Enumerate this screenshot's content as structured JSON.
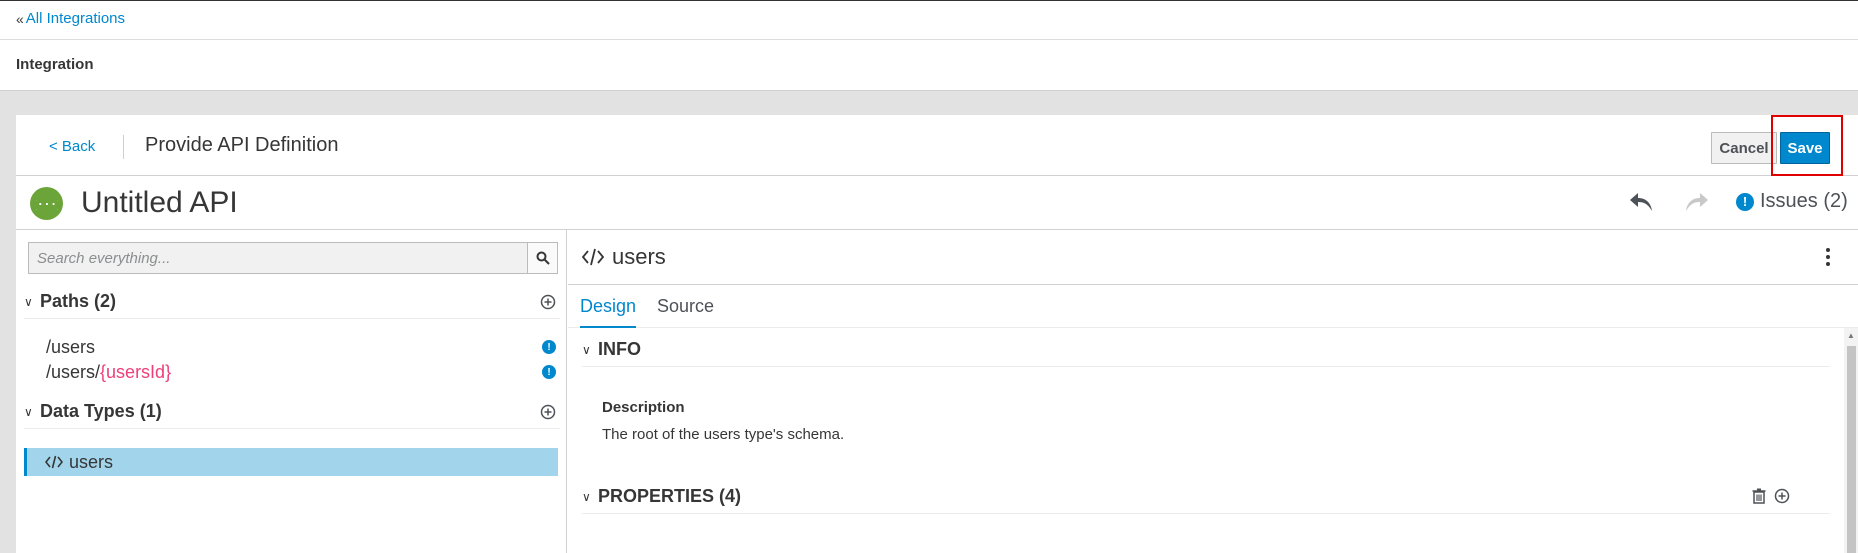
{
  "breadcrumb": {
    "link_label": "All Integrations"
  },
  "header": {
    "title": "Integration"
  },
  "step": {
    "back_label": "< Back",
    "title": "Provide API Definition",
    "cancel_label": "Cancel",
    "save_label": "Save"
  },
  "api": {
    "title": "Untitled API",
    "issues_label": "Issues (2)"
  },
  "sidebar": {
    "search_placeholder": "Search everything...",
    "paths_header": "Paths (2)",
    "paths": [
      {
        "prefix": "/users",
        "param": ""
      },
      {
        "prefix": "/users/",
        "param": "{usersId}"
      }
    ],
    "datatypes_header": "Data Types (1)",
    "datatypes": [
      {
        "label": "users"
      }
    ]
  },
  "editor": {
    "title": "users",
    "tabs": [
      {
        "label": "Design"
      },
      {
        "label": "Source"
      }
    ],
    "info_header": "INFO",
    "description_label": "Description",
    "description_text": "The root of the users type's schema.",
    "properties_header": "PROPERTIES (4)"
  },
  "colors": {
    "accent": "#0088ce",
    "save_highlight": "#e00000",
    "selected_row": "#a2d5ec",
    "path_param": "#ec407a",
    "logo": "#6ba539"
  }
}
